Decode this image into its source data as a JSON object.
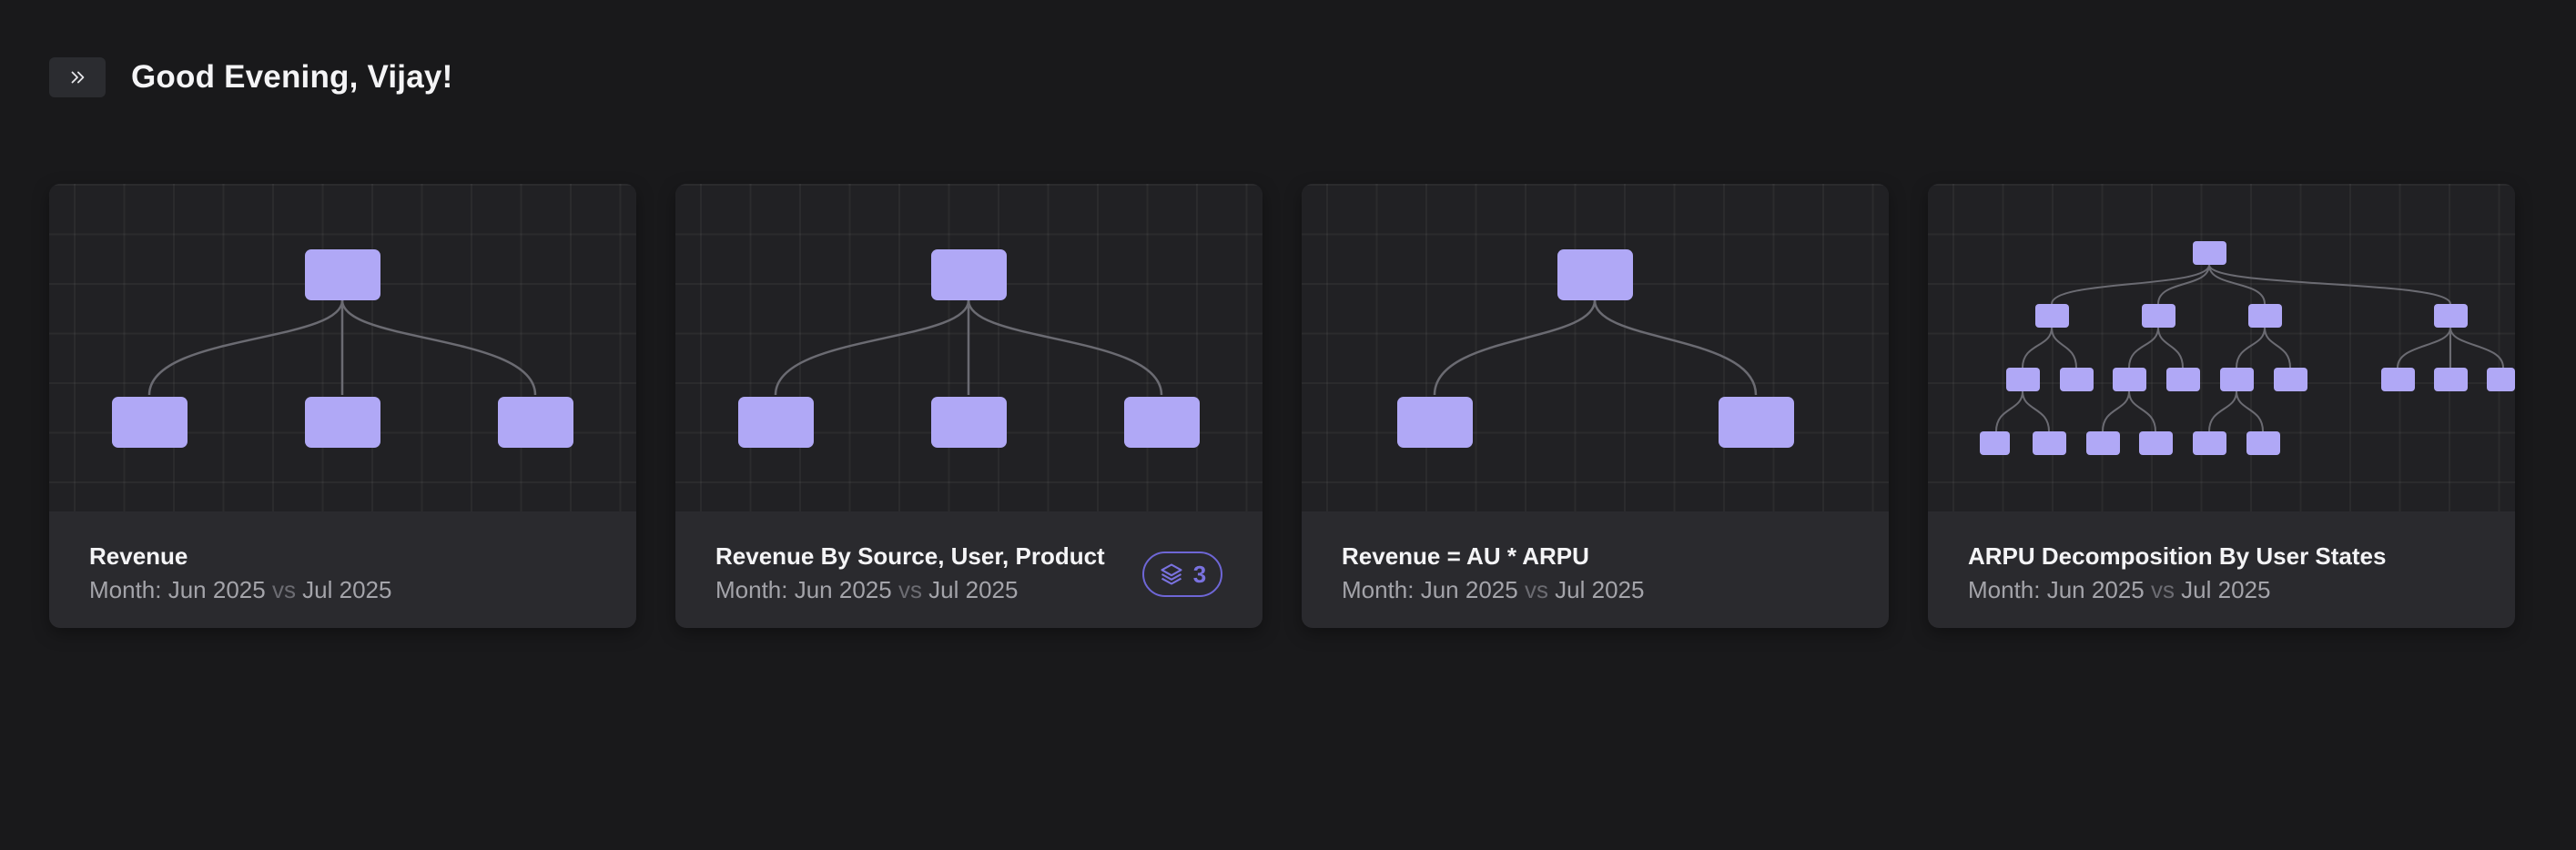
{
  "header": {
    "expand_icon": "chevrons-right-icon",
    "greeting": "Good Evening, Vijay!"
  },
  "colors": {
    "background": "#19191b",
    "card": "#2a2a2e",
    "node": "#b0a8f6",
    "accent": "#6e66d6"
  },
  "cards": [
    {
      "title": "Revenue",
      "month_prefix": "Month: Jun 2025",
      "vs": "vs",
      "compare": "Jul 2025"
    },
    {
      "title": "Revenue By Source, User, Product",
      "month_prefix": "Month: Jun 2025",
      "vs": "vs",
      "compare": "Jul 2025",
      "badge_icon": "layers-icon",
      "badge_count": "3"
    },
    {
      "title": "Revenue = AU * ARPU",
      "month_prefix": "Month: Jun 2025",
      "vs": "vs",
      "compare": "Jul 2025"
    },
    {
      "title": "ARPU Decomposition By User States",
      "month_prefix": "Month: Jun 2025",
      "vs": "vs",
      "compare": "Jul 2025"
    }
  ]
}
